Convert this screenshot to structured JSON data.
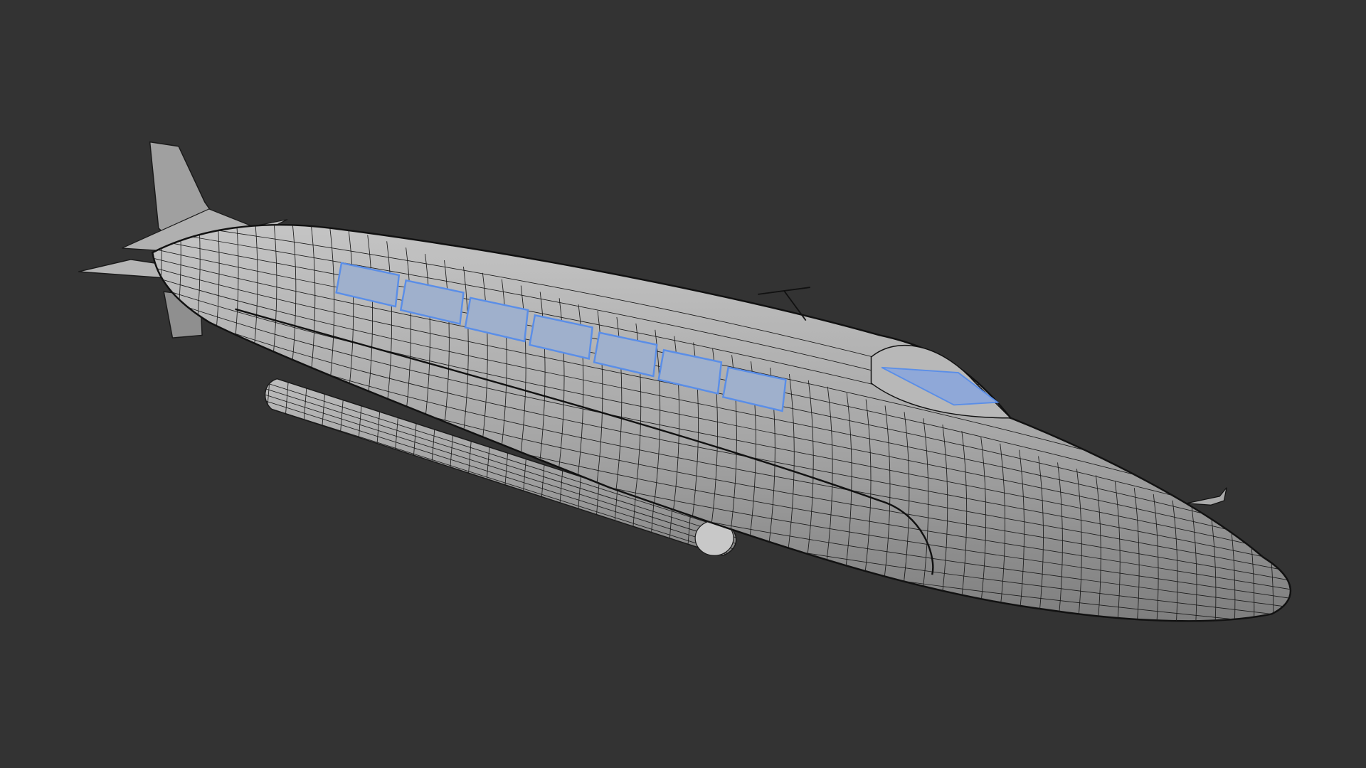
{
  "scene": {
    "background_color": "#333333",
    "model_fill_color": "#a8a8a8",
    "wire_color": "#1a1a1a",
    "selection_color": "#5a8ee8"
  }
}
